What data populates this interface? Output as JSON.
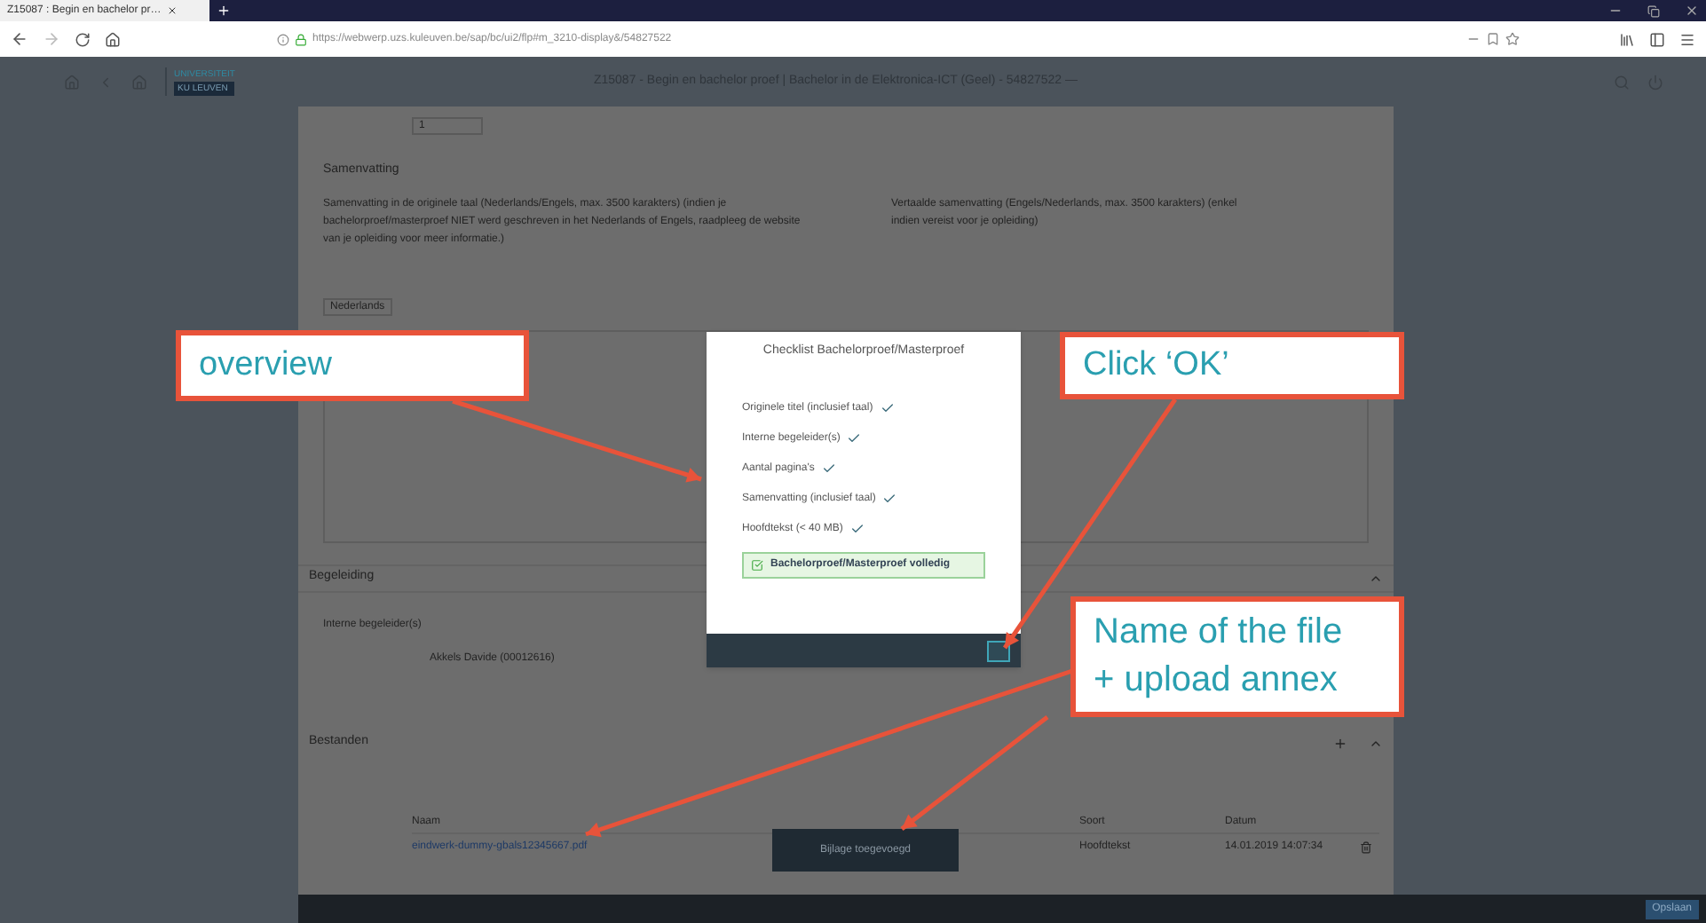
{
  "browser": {
    "tab_title": "Z15087 : Begin en bachelor pr…",
    "url": "https://webwerp.uzs.kuleuven.be/sap/bc/ui2/flp#m_3210-display&/54827522"
  },
  "app": {
    "logo_top": "UNIVERSITEIT",
    "logo_bottom": "KU LEUVEN",
    "title": "Z15087 - Begin en bachelor proef | Bachelor in de Elektronica-ICT (Geel) - 54827522 —"
  },
  "form": {
    "field_value": "1",
    "summary_heading": "Samenvatting",
    "summary_left": "Samenvatting in de originele taal (Nederlands/Engels, max. 3500 karakters) (indien je bachelorproef/masterproef NIET werd geschreven in het Nederlands of Engels, raadpleeg de website van je opleiding voor meer informatie.)",
    "summary_right": "Vertaalde samenvatting (Engels/Nederlands, max. 3500 karakters) (enkel indien vereist voor je opleiding)",
    "language": "Nederlands"
  },
  "guidance": {
    "heading": "Begeleiding",
    "label": "Interne begeleider(s)",
    "value": "Akkels Davide (00012616)"
  },
  "files": {
    "heading": "Bestanden",
    "columns": [
      "Naam",
      "Soort",
      "Datum"
    ],
    "rows": [
      {
        "name": "eindwerk-dummy-gbals12345667.pdf",
        "type": "Hoofdtekst",
        "date": "14.01.2019 14:07:34"
      }
    ]
  },
  "toast": "Bijlage toegevoegd",
  "save_button": "Opslaan",
  "dialog": {
    "title": "Checklist Bachelorproef/Masterproef",
    "items": [
      {
        "label": "Originele titel (inclusief taal)",
        "checked": true
      },
      {
        "label": "Interne begeleider(s)",
        "checked": true
      },
      {
        "label": "Aantal pagina's",
        "checked": true
      },
      {
        "label": "Samenvatting (inclusief taal)",
        "checked": true
      },
      {
        "label": "Hoofdtekst (< 40 MB)",
        "checked": true
      }
    ],
    "status": {
      "label": "Bachelorproef/Masterproef volledig",
      "complete": true
    }
  },
  "callouts": [
    "overview",
    "Click ‘OK’",
    "Name of the file + upload annex"
  ]
}
